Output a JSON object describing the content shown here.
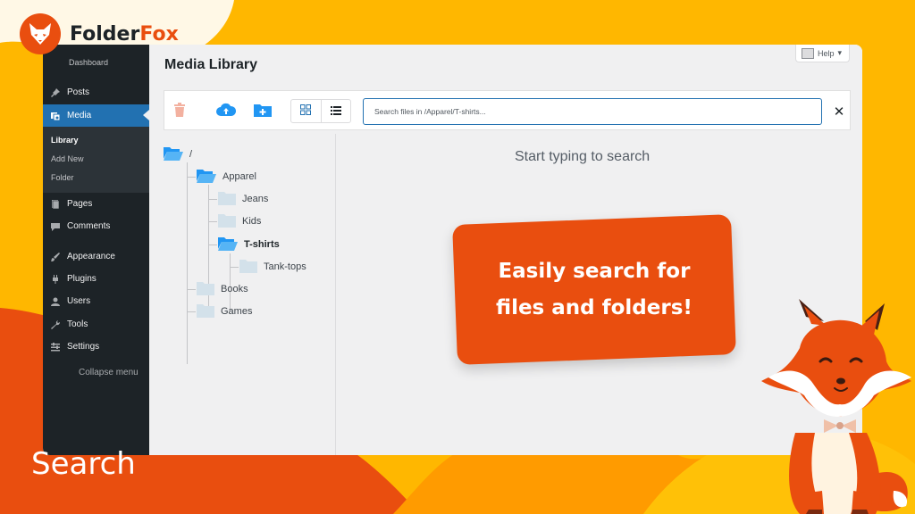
{
  "brand": {
    "name_part1": "Folder",
    "name_part2": "Fox",
    "icon": "fox-logo-icon",
    "accent": "#e94e0f",
    "background": "#ffb700"
  },
  "slide_label": "Search",
  "callout": {
    "line1": "Easily search for",
    "line2": "files and folders!"
  },
  "wp_sidebar": {
    "dashboard_label": "Dashboard",
    "items": [
      {
        "label": "Posts",
        "icon": "pin-icon"
      },
      {
        "label": "Media",
        "icon": "media-icon",
        "active": true
      },
      {
        "label": "Pages",
        "icon": "page-icon"
      },
      {
        "label": "Comments",
        "icon": "comment-icon"
      },
      {
        "label": "Appearance",
        "icon": "brush-icon"
      },
      {
        "label": "Plugins",
        "icon": "plug-icon"
      },
      {
        "label": "Users",
        "icon": "user-icon"
      },
      {
        "label": "Tools",
        "icon": "wrench-icon"
      },
      {
        "label": "Settings",
        "icon": "sliders-icon"
      }
    ],
    "submenu": [
      "Library",
      "Add New",
      "Folder"
    ],
    "collapse_label": "Collapse menu"
  },
  "page": {
    "title": "Media Library",
    "help_label": "Help"
  },
  "toolbar": {
    "delete_icon": "trash-icon",
    "upload_icon": "cloud-upload-icon",
    "new_folder_icon": "folder-plus-icon",
    "grid_icon": "grid-view-icon",
    "list_icon": "list-view-icon",
    "search_placeholder": "Search files in /Apparel/T-shirts...",
    "clear_label": "✕"
  },
  "tree": {
    "root": "/",
    "folders": [
      {
        "label": "Apparel",
        "children": [
          {
            "label": "Jeans"
          },
          {
            "label": "Kids"
          },
          {
            "label": "T-shirts",
            "selected": true,
            "children": [
              {
                "label": "Tank-tops"
              }
            ]
          }
        ]
      },
      {
        "label": "Books"
      },
      {
        "label": "Games"
      }
    ]
  },
  "results": {
    "empty_message": "Start typing to search"
  }
}
